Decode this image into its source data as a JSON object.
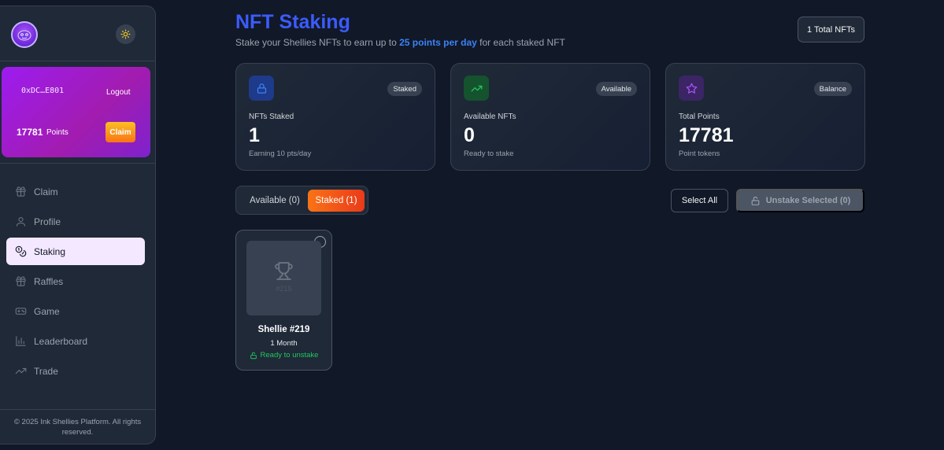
{
  "sidebar": {
    "wallet": {
      "address": "0xDC…E801",
      "logout_label": "Logout",
      "points": "17781",
      "points_label": "Points",
      "claim_label": "Claim"
    },
    "items": [
      {
        "label": "Claim",
        "icon": "gift-icon"
      },
      {
        "label": "Profile",
        "icon": "user-icon"
      },
      {
        "label": "Staking",
        "icon": "coins-icon",
        "active": true
      },
      {
        "label": "Raffles",
        "icon": "gift-icon"
      },
      {
        "label": "Game",
        "icon": "gamepad-icon"
      },
      {
        "label": "Leaderboard",
        "icon": "bar-chart-icon"
      },
      {
        "label": "Trade",
        "icon": "trending-up-icon"
      }
    ],
    "footer": "© 2025 Ink Shellies Platform. All rights reserved."
  },
  "header": {
    "title": "NFT Staking",
    "subtitle_pre": "Stake your Shellies NFTs to earn up to ",
    "subtitle_highlight": "25 points per day",
    "subtitle_post": " for each staked NFT",
    "total_label": "1 Total NFTs"
  },
  "cards": [
    {
      "badge": "Staked",
      "label": "NFTs Staked",
      "value": "1",
      "sub": "Earning 10 pts/day",
      "icon": "lock-icon",
      "color": "#3b82f6"
    },
    {
      "badge": "Available",
      "label": "Available NFTs",
      "value": "0",
      "sub": "Ready to stake",
      "icon": "trending-up-icon",
      "color": "#22c55e"
    },
    {
      "badge": "Balance",
      "label": "Total Points",
      "value": "17781",
      "sub": "Point tokens",
      "icon": "star-icon",
      "color": "#a855f7"
    }
  ],
  "tabs": {
    "available": "Available (0)",
    "staked": "Staked (1)"
  },
  "actions": {
    "select_all": "Select All",
    "unstake": "Unstake Selected (0)"
  },
  "nft": {
    "image_number": "#219",
    "name": "Shellie #219",
    "duration": "1 Month",
    "status": "Ready to unstake"
  }
}
